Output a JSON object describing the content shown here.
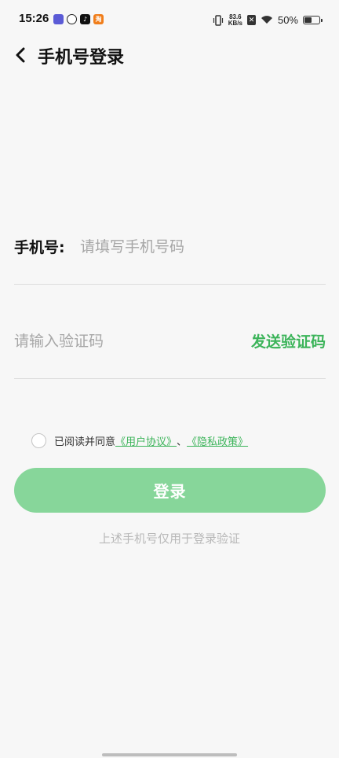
{
  "status_bar": {
    "time": "15:26",
    "notification_icons": [
      "app-icon",
      "link-icon",
      "tiktok-icon",
      "taobao-icon"
    ],
    "net_speed_value": "83.6",
    "net_speed_unit": "KB/s",
    "battery_text": "50%",
    "battery_level": 0.5
  },
  "header": {
    "title": "手机号登录"
  },
  "form": {
    "phone_label": "手机号:",
    "phone_placeholder": "请填写手机号码",
    "code_placeholder": "请输入验证码",
    "send_code_label": "发送验证码"
  },
  "agreement": {
    "prefix": "已阅读并同意",
    "user_agreement": "《用户协议》",
    "separator": "、",
    "privacy_policy": "《隐私政策》",
    "checked": false
  },
  "login": {
    "button_label": "登录",
    "hint": "上述手机号仅用于登录验证"
  },
  "colors": {
    "accent": "#3cb45a",
    "button_disabled": "#87d69a",
    "background": "#f7f7f7"
  }
}
